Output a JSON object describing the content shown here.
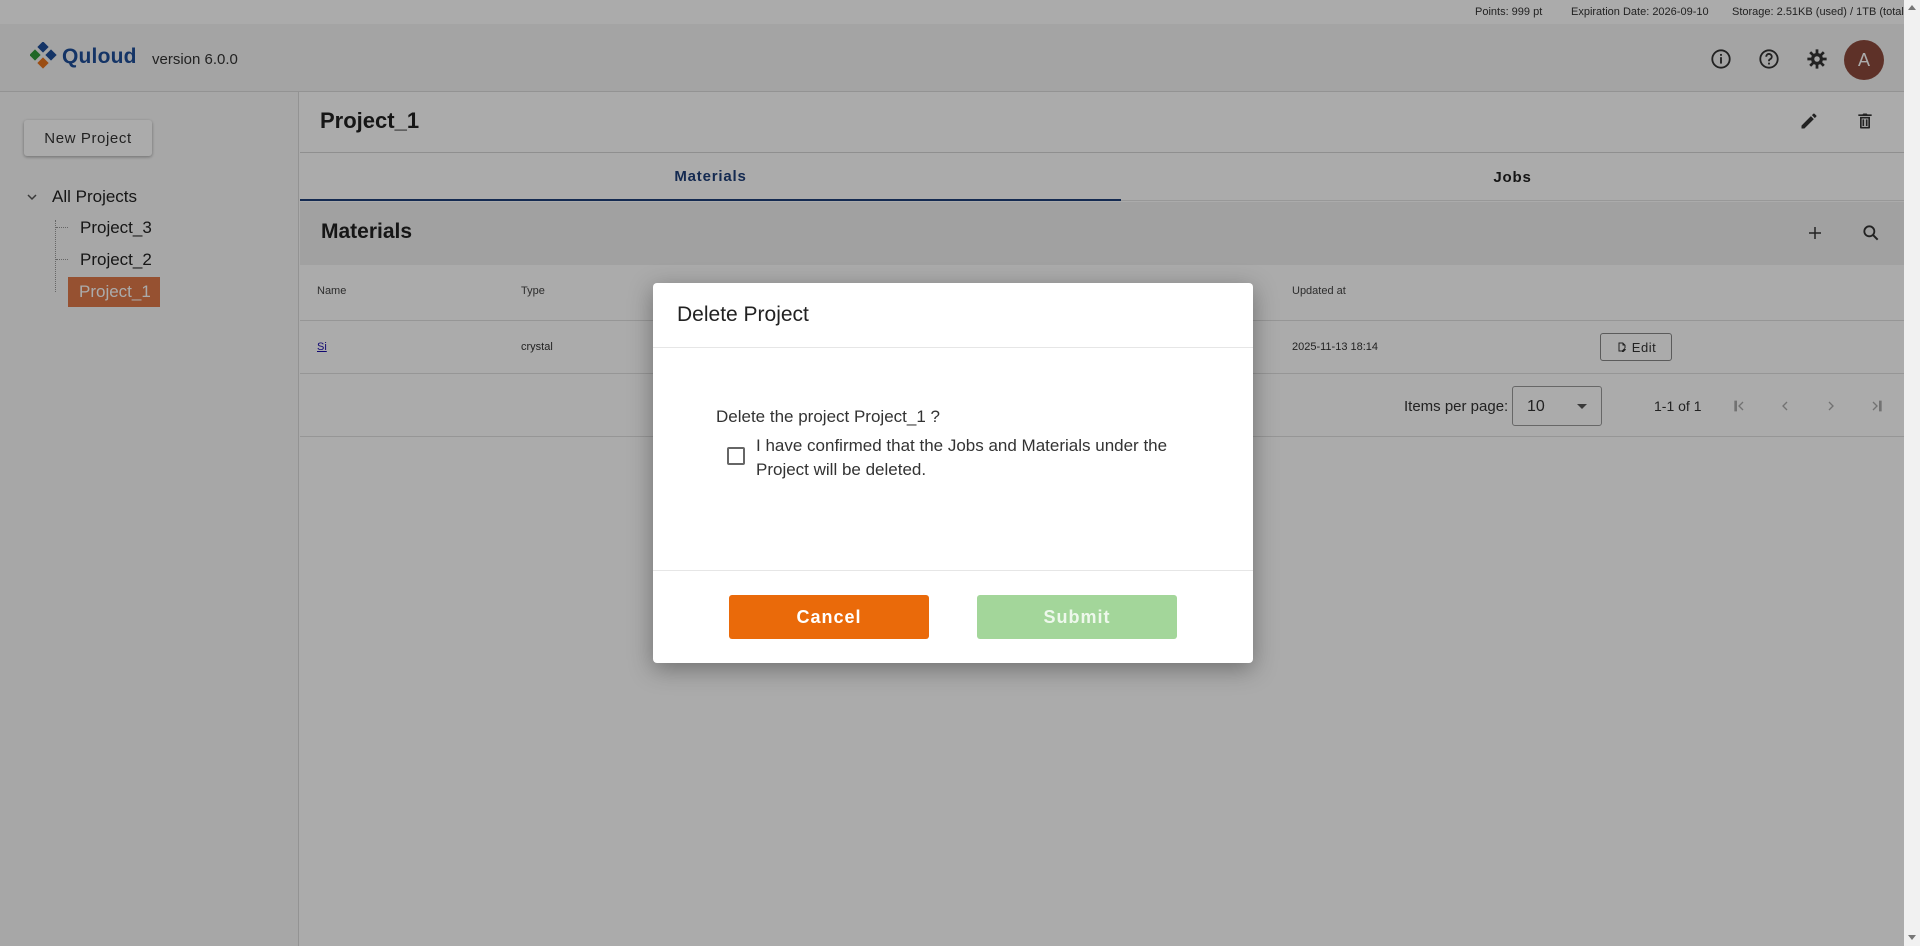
{
  "status": {
    "points": "Points: 999 pt",
    "expiration": "Expiration Date: 2026-09-10",
    "storage": "Storage: 2.51KB (used) / 1TB (total)"
  },
  "header": {
    "logo_text": "Quloud",
    "version": "version 6.0.0",
    "avatar_initial": "A",
    "icons": [
      "info-icon",
      "help-icon",
      "settings-icon"
    ]
  },
  "sidebar": {
    "new_project_label": "New Project",
    "root_label": "All Projects",
    "items": [
      {
        "label": "Project_3",
        "active": false
      },
      {
        "label": "Project_2",
        "active": false
      },
      {
        "label": "Project_1",
        "active": true
      }
    ]
  },
  "main": {
    "project_title": "Project_1",
    "tabs": [
      {
        "label": "Materials",
        "active": true
      },
      {
        "label": "Jobs",
        "active": false
      }
    ],
    "section_title": "Materials",
    "table": {
      "headers": {
        "name": "Name",
        "type": "Type",
        "updated": "Updated at"
      },
      "rows": [
        {
          "name": "Si",
          "type": "crystal",
          "updated": "2025-11-13 18:14",
          "action": "Edit"
        }
      ]
    },
    "pagination": {
      "items_per_page_label": "Items per page:",
      "items_per_page": "10",
      "range": "1-1 of 1"
    }
  },
  "dialog": {
    "title": "Delete Project",
    "question": "Delete the project Project_1 ?",
    "confirm_text": "I have confirmed that the Jobs and Materials under the Project will be deleted.",
    "cancel_label": "Cancel",
    "submit_label": "Submit"
  },
  "colors": {
    "brand": "#1f4e99",
    "active_item": "#e07a4a",
    "cancel": "#ea6a0a",
    "submit_disabled": "#a3d69a",
    "avatar": "#8c4a3c"
  }
}
